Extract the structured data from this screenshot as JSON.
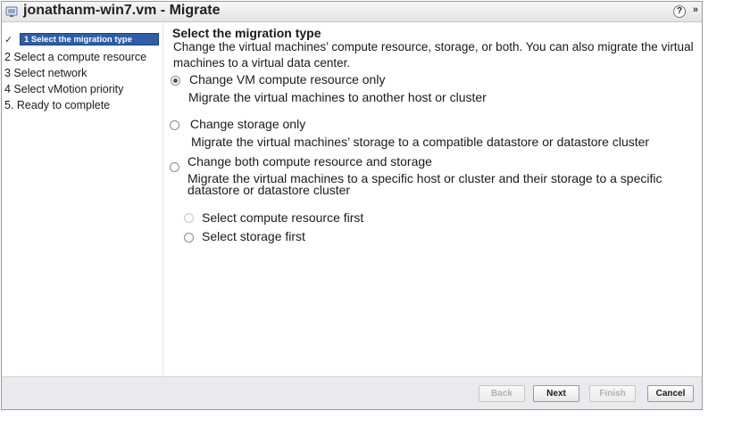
{
  "window": {
    "vm_name": "jonathanm-win7.vm",
    "separator": " - ",
    "action": "Migrate",
    "help_label": "?",
    "expand_label": "»"
  },
  "steps": [
    {
      "label": "1  Select the migration type",
      "state": "current"
    },
    {
      "label": "2 Select a compute resource",
      "state": "pending"
    },
    {
      "label": "3 Select network",
      "state": "pending"
    },
    {
      "label": "4 Select vMotion priority",
      "state": "pending"
    },
    {
      "label": "5. Ready to complete",
      "state": "pending"
    }
  ],
  "page": {
    "heading": "Select the migration type",
    "intro": "Change the virtual machines’ compute resource, storage, or both. You can also migrate the virtual machines to a virtual data center."
  },
  "options": [
    {
      "label": "Change VM compute resource only",
      "description": "Migrate the virtual machines to another host or cluster",
      "selected": true
    },
    {
      "label": "Change storage only",
      "description": "Migrate the virtual machines’ storage to a compatible datastore or datastore cluster",
      "selected": false
    },
    {
      "label": "Change both compute resource and storage",
      "description": "Migrate the virtual machines to a specific host or cluster and their storage to a specific datastore or datastore cluster",
      "selected": false
    }
  ],
  "sub_options": [
    {
      "label": "Select compute resource first",
      "selected": false
    },
    {
      "label": "Select storage first",
      "selected": false
    }
  ],
  "buttons": {
    "back": {
      "label": "Back",
      "enabled": false
    },
    "next": {
      "label": "Next",
      "enabled": true
    },
    "finish": {
      "label": "Finish",
      "enabled": false
    },
    "cancel": {
      "label": "Cancel",
      "enabled": true
    }
  },
  "colors": {
    "current_step_bg": "#2f5ea8",
    "footer_bg": "#e9e9ee"
  }
}
